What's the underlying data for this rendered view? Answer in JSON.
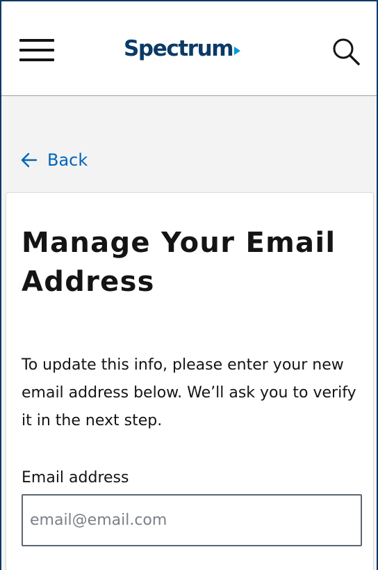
{
  "header": {
    "logo_text": "Spectrum",
    "menu_icon": "hamburger-menu-icon",
    "search_icon": "search-icon"
  },
  "back_link": {
    "label": "Back",
    "icon": "arrow-left-icon"
  },
  "form": {
    "title": "Manage Your Email Address",
    "description": "To update this info, please enter your new email address below. We’ll ask you to verify it in the next step.",
    "email_label": "Email address",
    "email_placeholder": "email@email.com",
    "email_value": ""
  },
  "colors": {
    "brand_navy": "#0b3a67",
    "brand_arrow": "#0099d8",
    "link_blue": "#0065b8",
    "page_background": "#f3f3f4",
    "text": "#141414"
  }
}
